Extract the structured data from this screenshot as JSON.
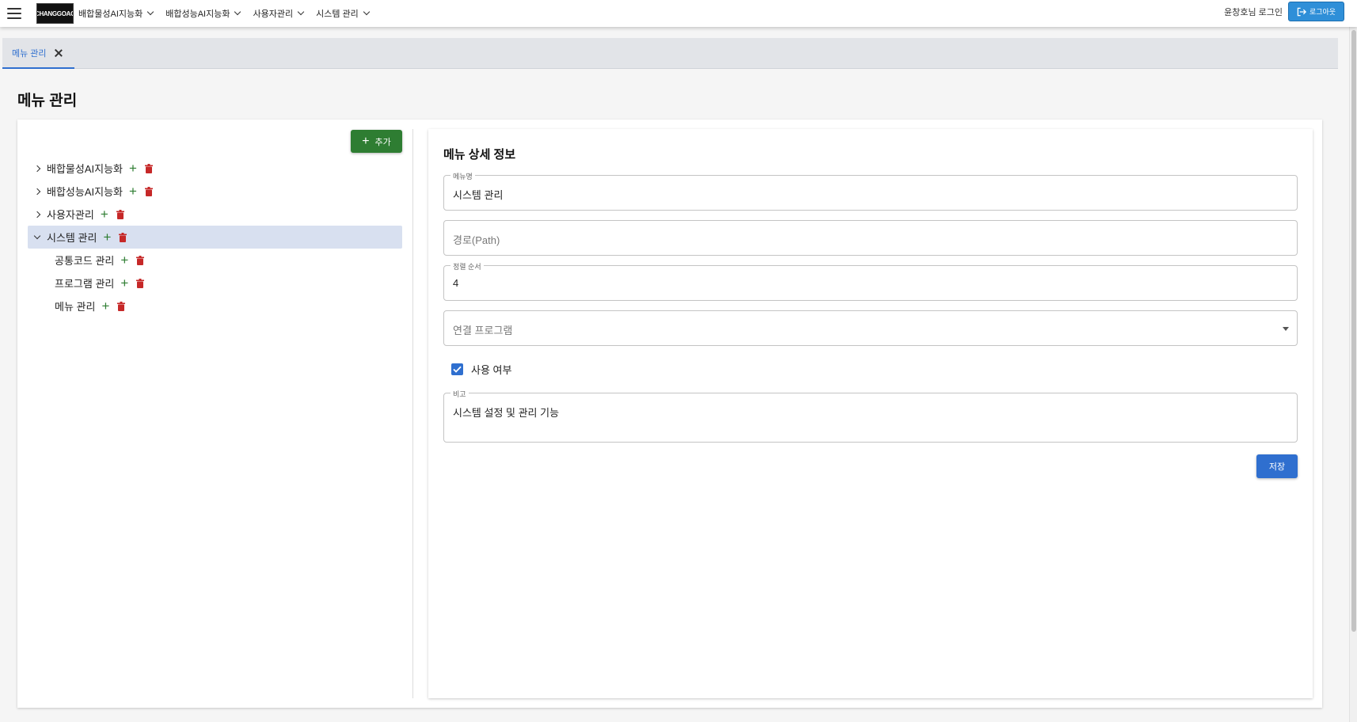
{
  "topbar": {
    "logo_text": "CHANGGOAO",
    "nav": [
      {
        "label": "배합물성AI지능화"
      },
      {
        "label": "배합성능AI지능화"
      },
      {
        "label": "사용자관리"
      },
      {
        "label": "시스템 관리"
      }
    ],
    "login_text": "윤창호님 로그인",
    "logout_label": "로그아웃"
  },
  "tabs": [
    {
      "label": "메뉴 관리"
    }
  ],
  "page_title": "메뉴 관리",
  "left": {
    "add_label": "추가",
    "tree": [
      {
        "label": "배합물성AI지능화",
        "expanded": false
      },
      {
        "label": "배합성능AI지능화",
        "expanded": false
      },
      {
        "label": "사용자관리",
        "expanded": false
      },
      {
        "label": "시스템 관리",
        "expanded": true,
        "selected": true
      },
      {
        "label": "공통코드 관리"
      },
      {
        "label": "프로그램 관리"
      },
      {
        "label": "메뉴 관리"
      }
    ]
  },
  "detail": {
    "title": "메뉴 상세 정보",
    "menu_name": {
      "label": "메뉴명",
      "value": "시스템 관리"
    },
    "path": {
      "placeholder": "경로(Path)"
    },
    "sort_order": {
      "label": "정렬 순서",
      "value": "4"
    },
    "program": {
      "placeholder": "연결 프로그램"
    },
    "use_yn": {
      "label": "사용 여부",
      "checked": true
    },
    "remark": {
      "label": "비고",
      "value": "시스템 설정 및 관리 기능"
    },
    "save_label": "저장"
  },
  "colors": {
    "primary": "#2f6fcf",
    "add_green": "#2e7d32",
    "delete_red": "#c62828",
    "logout_blue": "#2f8fd8",
    "selected_row": "#d8e0f0"
  }
}
